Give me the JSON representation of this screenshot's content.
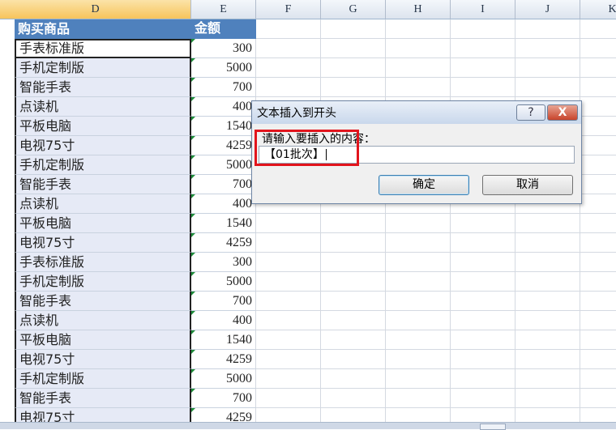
{
  "columns": [
    "D",
    "E",
    "F",
    "G",
    "H",
    "I",
    "J",
    "K"
  ],
  "header": {
    "product_label": "购买商品",
    "amount_label": "金额"
  },
  "rows": [
    {
      "product": "手表标准版",
      "amount": "300"
    },
    {
      "product": "手机定制版",
      "amount": "5000"
    },
    {
      "product": "智能手表",
      "amount": "700"
    },
    {
      "product": "点读机",
      "amount": "400"
    },
    {
      "product": "平板电脑",
      "amount": "1540"
    },
    {
      "product": "电视75寸",
      "amount": "4259"
    },
    {
      "product": "手机定制版",
      "amount": "5000"
    },
    {
      "product": "智能手表",
      "amount": "700"
    },
    {
      "product": "点读机",
      "amount": "400"
    },
    {
      "product": "平板电脑",
      "amount": "1540"
    },
    {
      "product": "电视75寸",
      "amount": "4259"
    },
    {
      "product": "手表标准版",
      "amount": "300"
    },
    {
      "product": "手机定制版",
      "amount": "5000"
    },
    {
      "product": "智能手表",
      "amount": "700"
    },
    {
      "product": "点读机",
      "amount": "400"
    },
    {
      "product": "平板电脑",
      "amount": "1540"
    },
    {
      "product": "电视75寸",
      "amount": "4259"
    },
    {
      "product": "手机定制版",
      "amount": "5000"
    },
    {
      "product": "智能手表",
      "amount": "700"
    },
    {
      "product": "电视75寸",
      "amount": "4259"
    }
  ],
  "dialog": {
    "title": "文本插入到开头",
    "help_label": "?",
    "close_label": "X",
    "prompt": "请输入要插入的内容：",
    "input_value": "【01批次】",
    "ok_label": "确定",
    "cancel_label": "取消"
  },
  "colors": {
    "header_bg": "#4f81bd",
    "highlight": "#e2141c",
    "selected_col": "#f7c45b"
  }
}
